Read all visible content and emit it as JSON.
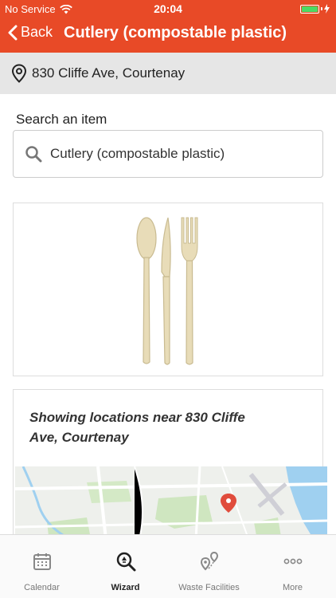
{
  "status_bar": {
    "carrier": "No Service",
    "time": "20:04"
  },
  "nav": {
    "back_label": "Back",
    "title": "Cutlery (compostable plastic)"
  },
  "location": {
    "address": "830 Cliffe Ave, Courtenay"
  },
  "search": {
    "label": "Search an item",
    "value": "Cutlery (compostable plastic)"
  },
  "map_section": {
    "heading": "Showing locations near 830 Cliffe Ave, Courtenay"
  },
  "tabs": [
    {
      "label": "Calendar",
      "icon": "calendar-icon",
      "active": false
    },
    {
      "label": "Wizard",
      "icon": "recycle-search-icon",
      "active": true
    },
    {
      "label": "Waste Facilities",
      "icon": "map-pin-icon",
      "active": false
    },
    {
      "label": "More",
      "icon": "more-dots-icon",
      "active": false
    }
  ],
  "colors": {
    "brand": "#e84a27",
    "battery": "#4cd964",
    "map_pin": "#e04c3c"
  }
}
